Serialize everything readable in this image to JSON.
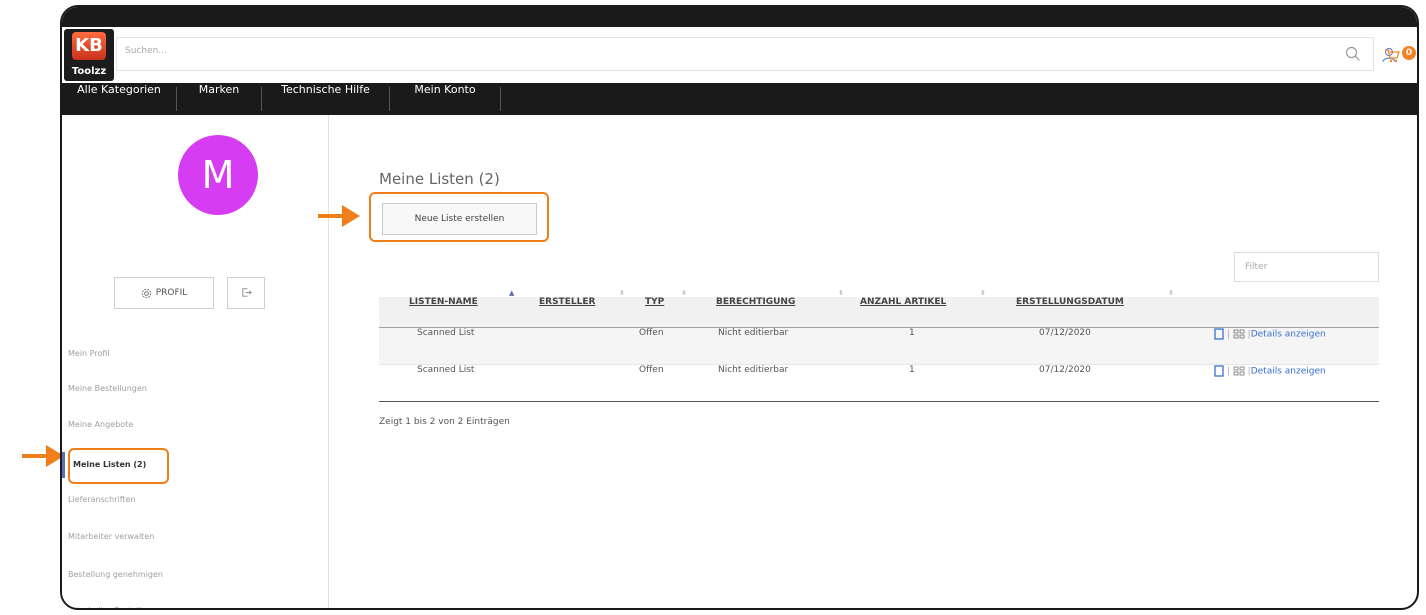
{
  "header": {
    "logo_text": "KB",
    "brand": "Toolzz",
    "search_placeholder": "Suchen...",
    "cart_count": "0"
  },
  "nav": {
    "items": [
      "Alle Kategorien",
      "Marken",
      "Technische Hilfe",
      "Mein Konto"
    ]
  },
  "sidebar": {
    "avatar_letter": "M",
    "profil_label": "PROFIL",
    "menu": [
      "Mein Profil",
      "Meine Bestellungen",
      "Meine Angebote",
      "Meine Listen (2)",
      "Lieferanschriften",
      "Mitarbeiter verwalten",
      "Bestellung genehmigen",
      "Mitarbeiter-Bestellungen"
    ],
    "active_index": 3
  },
  "main": {
    "title": "Meine Listen (2)",
    "new_list_button": "Neue Liste erstellen",
    "filter_placeholder": "Filter",
    "table": {
      "headers": [
        "LISTEN-NAME",
        "ERSTELLER",
        "TYP",
        "BERECHTIGUNG",
        "ANZAHL ARTIKEL",
        "ERSTELLUNGSDATUM"
      ],
      "rows": [
        {
          "name": "Scanned List",
          "creator": "",
          "type": "Offen",
          "permission": "Nicht editierbar",
          "count": "1",
          "date": "07/12/2020",
          "action": "Details anzeigen"
        },
        {
          "name": "Scanned List",
          "creator": "",
          "type": "Offen",
          "permission": "Nicht editierbar",
          "count": "1",
          "date": "07/12/2020",
          "action": "Details anzeigen"
        }
      ]
    },
    "info": "Zeigt 1 bis 2 von 2 Einträgen"
  },
  "colors": {
    "accent": "#f07f1b",
    "nav_bg": "#1a1a1a",
    "avatar": "#d63df3",
    "link": "#3a6fd1",
    "active_bar": "#5f6db2"
  },
  "icons": [
    "search-icon",
    "user-icon",
    "cart-icon",
    "gear-icon",
    "logout-icon",
    "copy-icon",
    "barcode-icon",
    "arrow-right-icon"
  ]
}
